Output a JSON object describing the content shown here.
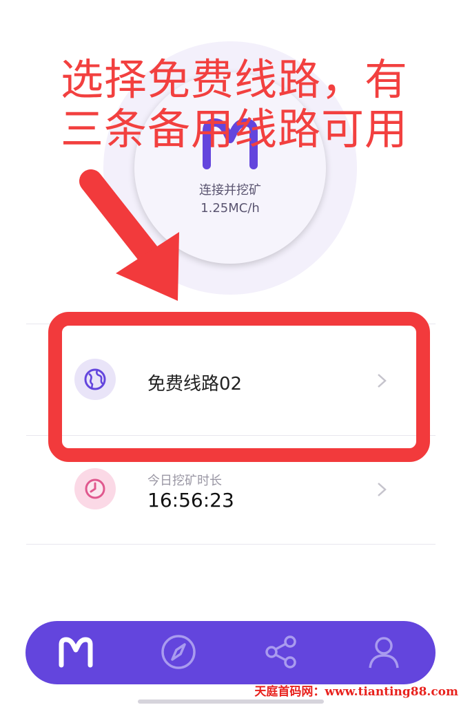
{
  "mining": {
    "status_label": "连接并挖矿",
    "rate": "1.25MC/h"
  },
  "route_row": {
    "icon": "globe-icon",
    "title": "免费线路02"
  },
  "timer_row": {
    "icon": "clock-icon",
    "label": "今日挖矿时长",
    "value": "16:56:23"
  },
  "annotation": {
    "headline_line1": "选择免费线路，有",
    "headline_line2": "三条备用线路可用"
  },
  "nav": {
    "items": [
      "mining-logo-icon",
      "compass-icon",
      "share-icon",
      "user-icon"
    ]
  },
  "watermark": "天庭首码网：www.tianting88.com",
  "colors": {
    "accent": "#6345dd",
    "annotation_red": "#f23a3c",
    "route_icon_bg": "#e9e4f8",
    "timer_icon_bg": "#fbd9e6"
  }
}
